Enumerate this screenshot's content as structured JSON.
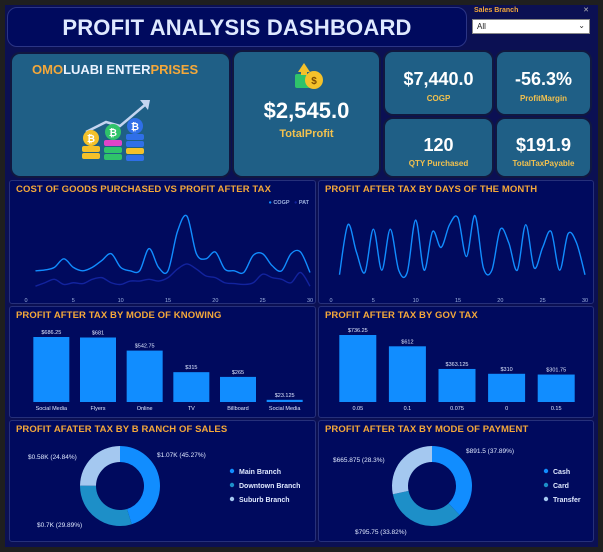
{
  "header": {
    "title": "PROFIT ANALYSIS DASHBOARD"
  },
  "slicer": {
    "label": "Sales Branch",
    "value": "All"
  },
  "brand": {
    "part1": "OMO",
    "part2": "LUABI ENTER",
    "part3": "PRISES"
  },
  "kpis": {
    "total_profit": {
      "value": "$2,545.0",
      "label": "TotalProfit"
    },
    "cogp": {
      "value": "$7,440.0",
      "label": "COGP"
    },
    "profit_margin": {
      "value": "-56.3%",
      "label": "ProfitMargin"
    },
    "qty": {
      "value": "120",
      "label": "QTY Purchased"
    },
    "tax": {
      "value": "$191.9",
      "label": "TotalTaxPayable"
    }
  },
  "colors": {
    "accent": "#f4a83a",
    "bar": "#118dff",
    "line": "#118dff",
    "line2": "#12239e",
    "donut1": "#118dff",
    "donut2": "#1d8fc8",
    "donut3": "#a4c8f0"
  },
  "chart_data": [
    {
      "type": "line",
      "title": "COST OF GOODS PURCHASED VS PROFIT AFTER TAX",
      "x": [
        1,
        2,
        3,
        4,
        5,
        6,
        7,
        8,
        9,
        10,
        11,
        12,
        13,
        14,
        15,
        16,
        17,
        18,
        19,
        20,
        21,
        22,
        23,
        24,
        25,
        26,
        27,
        28,
        29,
        30
      ],
      "xticks": [
        "0",
        "5",
        "10",
        "15",
        "20",
        "25",
        "30"
      ],
      "series": [
        {
          "name": "COGP",
          "values": [
            130,
            135,
            150,
            200,
            150,
            130,
            150,
            190,
            230,
            150,
            130,
            130,
            260,
            150,
            130,
            360,
            450,
            230,
            200,
            240,
            140,
            130,
            120,
            220,
            230,
            160,
            130,
            230,
            240,
            120
          ]
        },
        {
          "name": "PAT",
          "values": [
            40,
            60,
            80,
            50,
            60,
            55,
            80,
            90,
            60,
            50,
            70,
            70,
            80,
            70,
            90,
            140,
            170,
            140,
            100,
            90,
            60,
            55,
            50,
            60,
            110,
            90,
            80,
            60,
            120,
            40
          ]
        }
      ]
    },
    {
      "type": "line",
      "title": "PROFIT AFTER TAX BY DAYS OF THE MONTH",
      "x": [
        1,
        2,
        3,
        4,
        5,
        6,
        7,
        8,
        9,
        10,
        11,
        12,
        13,
        14,
        15,
        16,
        17,
        18,
        19,
        20,
        21,
        22,
        23,
        24,
        25,
        26,
        27,
        28,
        29,
        30
      ],
      "xticks": [
        "0",
        "5",
        "10",
        "15",
        "20",
        "25",
        "30"
      ],
      "series": [
        {
          "name": "PAT",
          "values": [
            40,
            150,
            90,
            45,
            140,
            50,
            140,
            50,
            45,
            160,
            50,
            135,
            100,
            150,
            165,
            80,
            170,
            55,
            50,
            140,
            110,
            50,
            150,
            55,
            100,
            135,
            50,
            130,
            110,
            40
          ]
        }
      ]
    },
    {
      "type": "bar",
      "title": "PROFIT AFTER TAX BY MODE OF KNOWING",
      "categories": [
        "Social Media",
        "Flyers",
        "Online",
        "TV",
        "Billboard",
        "Social Media"
      ],
      "values": [
        686.25,
        681,
        542.75,
        315,
        265,
        23.125
      ],
      "labels": [
        "$686.25",
        "$681",
        "$542.75",
        "$315",
        "$265",
        "$23.125"
      ]
    },
    {
      "type": "bar",
      "title": "PROFIT AFTER TAX BY GOV TAX",
      "categories": [
        "0.05",
        "0.1",
        "0.075",
        "0",
        "0.15"
      ],
      "values": [
        736.25,
        612,
        363.125,
        310,
        301.75
      ],
      "labels": [
        "$736.25",
        "$612",
        "$363.125",
        "$310",
        "$301.75"
      ]
    },
    {
      "type": "pie",
      "title": "PROFIT AFATER TAX BY B RANCH OF SALES",
      "categories": [
        "Main Branch",
        "Downtown Branch",
        "Suburb Branch"
      ],
      "values": [
        45.27,
        29.89,
        24.84
      ],
      "labels": [
        "$1.07K (45.27%)",
        "$0.7K (29.89%)",
        "$0.58K (24.84%)"
      ]
    },
    {
      "type": "pie",
      "title": "PROFIT AFTER TAX BY MODE OF PAYMENT",
      "categories": [
        "Cash",
        "Card",
        "Transfer"
      ],
      "values": [
        37.89,
        33.82,
        28.3
      ],
      "labels": [
        "$891.5 (37.89%)",
        "$795.75 (33.82%)",
        "$665.875 (28.3%)"
      ]
    }
  ]
}
